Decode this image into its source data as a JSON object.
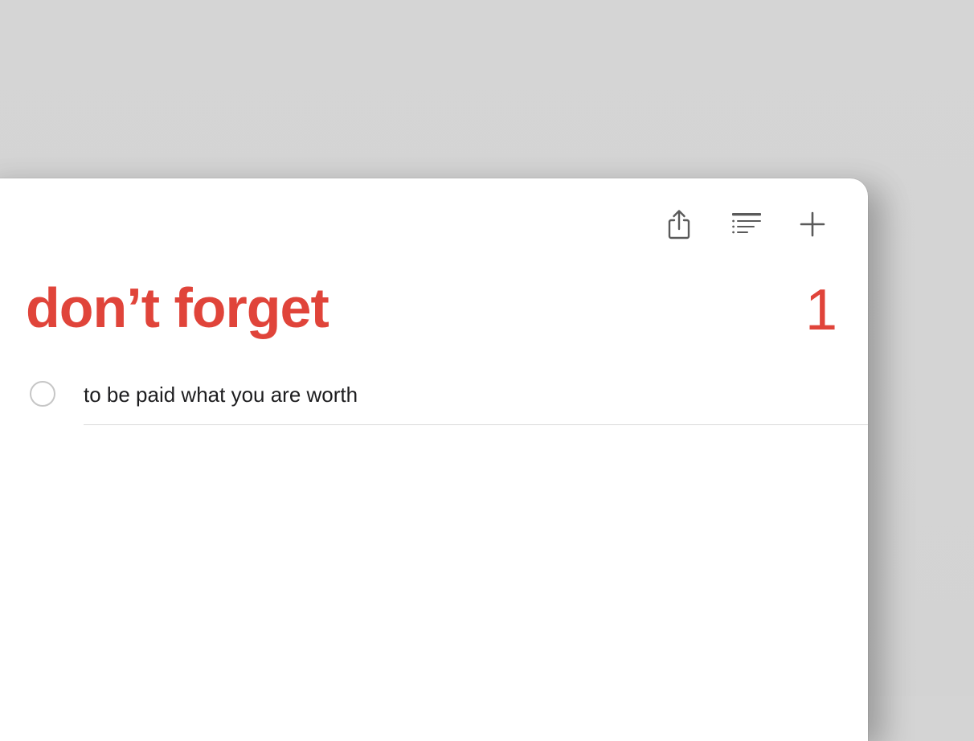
{
  "toolbar": {
    "share_icon": "share-icon",
    "view_icon": "list-view-icon",
    "add_icon": "plus-icon"
  },
  "list": {
    "title": "don’t forget",
    "count": "1",
    "accent_color": "#e0443a"
  },
  "reminders": [
    {
      "text": "to be paid what you are worth",
      "completed": false
    }
  ]
}
